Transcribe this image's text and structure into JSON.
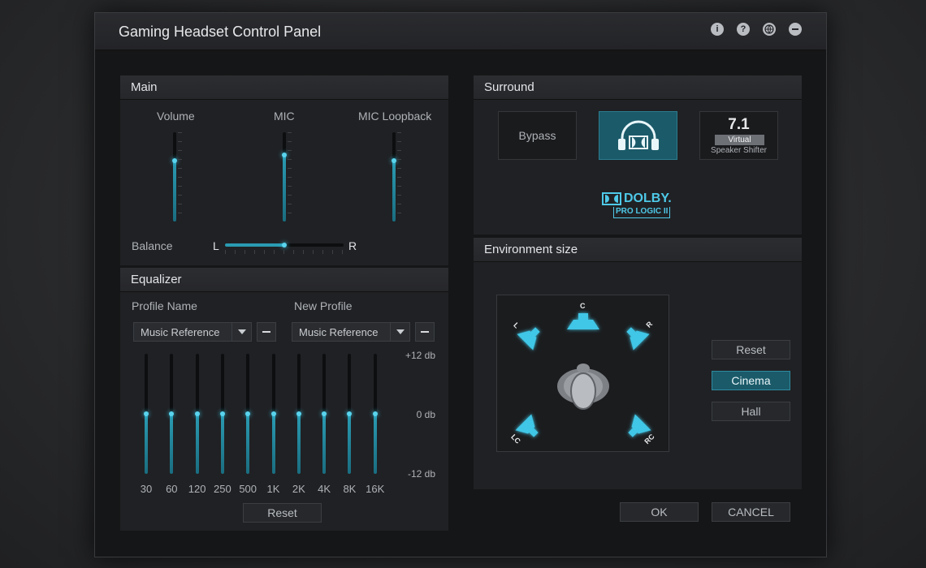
{
  "window": {
    "title": "Gaming Headset Control Panel",
    "titlebar_icons": [
      "info-icon",
      "help-icon",
      "globe-icon",
      "minimize-icon"
    ]
  },
  "main": {
    "header": "Main",
    "sliders": [
      {
        "label": "Volume",
        "level": 0.68
      },
      {
        "label": "MIC",
        "level": 0.75
      },
      {
        "label": "MIC Loopback",
        "level": 0.68
      }
    ],
    "balance": {
      "label": "Balance",
      "left": "L",
      "right": "R",
      "level": 0.5
    }
  },
  "equalizer": {
    "header": "Equalizer",
    "profile_name_label": "Profile Name",
    "profile_name_value": "Music Reference",
    "new_profile_label": "New Profile",
    "new_profile_value": "Music Reference",
    "db_labels": [
      "+12 db",
      "0 db",
      "-12 db"
    ],
    "bands": [
      {
        "label": "30",
        "level": 0.5
      },
      {
        "label": "60",
        "level": 0.5
      },
      {
        "label": "120",
        "level": 0.5
      },
      {
        "label": "250",
        "level": 0.5
      },
      {
        "label": "500",
        "level": 0.5
      },
      {
        "label": "1K",
        "level": 0.5
      },
      {
        "label": "2K",
        "level": 0.5
      },
      {
        "label": "4K",
        "level": 0.5
      },
      {
        "label": "8K",
        "level": 0.5
      },
      {
        "label": "16K",
        "level": 0.5
      }
    ],
    "reset_label": "Reset"
  },
  "surround": {
    "header": "Surround",
    "bypass_label": "Bypass",
    "virtual_big": "7.1",
    "virtual_tag": "Virtual",
    "virtual_sub": "Speaker Shifter",
    "dolby_brand": "DOLBY.",
    "dolby_sub": "PRO LOGIC II"
  },
  "environment": {
    "header": "Environment size",
    "speakers": [
      "L",
      "C",
      "R",
      "LC",
      "RC"
    ],
    "buttons": [
      {
        "label": "Reset",
        "active": false
      },
      {
        "label": "Cinema",
        "active": true
      },
      {
        "label": "Hall",
        "active": false
      }
    ]
  },
  "footer": {
    "ok_label": "OK",
    "cancel_label": "CANCEL"
  },
  "colors": {
    "accent": "#2a9bb2",
    "accent_glow": "#5ad4ee",
    "active_bg": "#1b5a69"
  }
}
